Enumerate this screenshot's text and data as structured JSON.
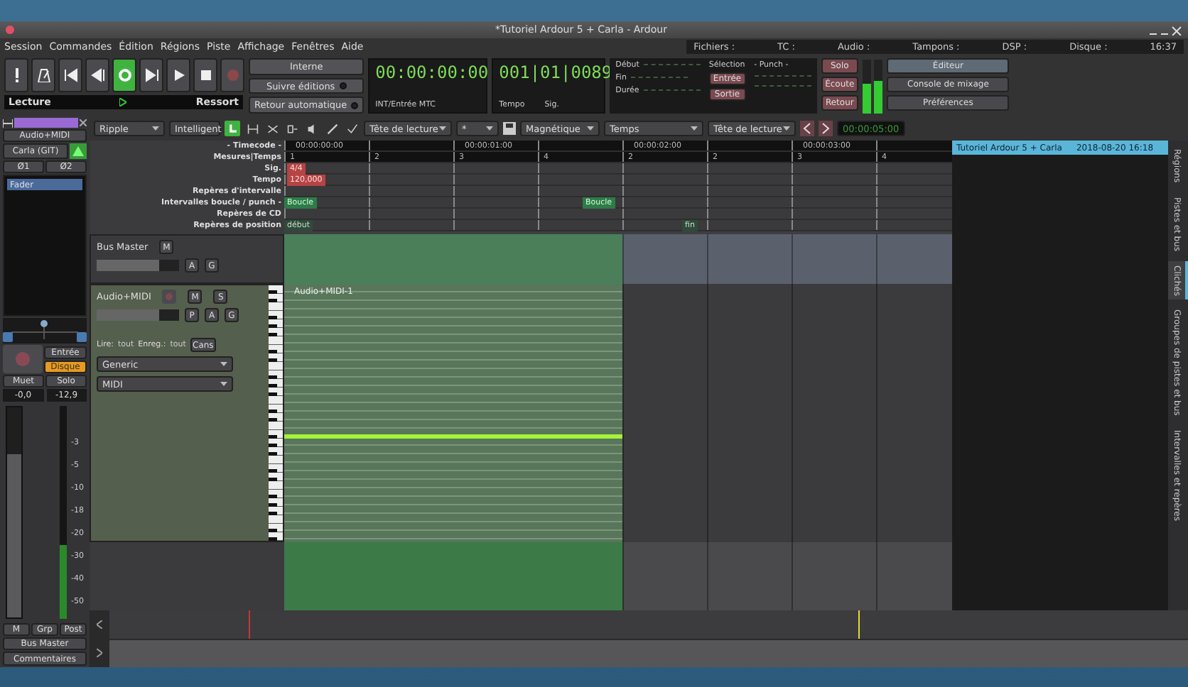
{
  "window": {
    "title": "*Tutoriel Ardour 5 + Carla - Ardour"
  },
  "menu": [
    "Session",
    "Commandes",
    "Édition",
    "Régions",
    "Piste",
    "Affichage",
    "Fenêtres",
    "Aide"
  ],
  "status": [
    "Fichiers :",
    "TC :",
    "Audio :",
    "Tampons :",
    "DSP :",
    "Disque :"
  ],
  "clock_time": "16:37",
  "transport": {
    "buttons": [
      {
        "kind": "alert",
        "on": false
      },
      {
        "kind": "metronome",
        "on": false
      },
      {
        "kind": "to-start",
        "on": false
      },
      {
        "kind": "to-prev",
        "on": false
      },
      {
        "kind": "loop",
        "on": true
      },
      {
        "kind": "to-end",
        "on": false
      },
      {
        "kind": "play",
        "on": false
      },
      {
        "kind": "stop",
        "on": false
      },
      {
        "kind": "record",
        "on": false
      }
    ],
    "sync": "Interne",
    "follow_edits": {
      "label": "Suivre éditions",
      "on": false
    },
    "auto_return": {
      "label": "Retour automatique",
      "on": false
    },
    "mode_left": "Lecture",
    "mode_right": "Ressort"
  },
  "clocks": {
    "primary": "00:00:00:00",
    "primary_info": "INT/Entrée MTC",
    "secondary": "001|01|0089",
    "tempo_label": "Tempo",
    "sig_label": "Sig."
  },
  "selection": {
    "title": "Sélection",
    "punch_title": "- Punch -",
    "rows": [
      "Début",
      "Fin",
      "Durée"
    ],
    "punch_in": "Entrée",
    "punch_out": "Sortie"
  },
  "monitor": [
    "Solo",
    "Écoute",
    "Retour"
  ],
  "windows": [
    {
      "label": "Éditeur",
      "selected": true
    },
    {
      "label": "Console de mixage",
      "selected": false
    },
    {
      "label": "Préférences",
      "selected": false
    }
  ],
  "toolbar": {
    "edit_mode": "Ripple",
    "tool_mode": "Intelligent",
    "edit_point": "Tête de lecture",
    "zoom_focus": "*",
    "snap_mode": "Magnétique",
    "grid": "Temps",
    "nudge_point": "Tête de lecture",
    "nudge_clock": "00:00:05:00",
    "tools": [
      {
        "kind": "grab",
        "selected": true
      },
      {
        "kind": "range",
        "selected": false
      },
      {
        "kind": "cut",
        "selected": false
      },
      {
        "kind": "stretch",
        "selected": false
      },
      {
        "kind": "audition",
        "selected": false
      },
      {
        "kind": "draw",
        "selected": false
      },
      {
        "kind": "internal",
        "selected": false
      }
    ]
  },
  "rulers": [
    {
      "kind": "timecode",
      "label": "- Timecode -",
      "marks": [
        "00:00:00:00",
        "00:00:01:00",
        "00:00:02:00",
        "00:00:03:00"
      ]
    },
    {
      "kind": "bars",
      "label": "Mesures|Temps",
      "marks": [
        "1",
        "2",
        "3",
        "4",
        "2",
        "2",
        "3",
        "4"
      ]
    },
    {
      "kind": "sig",
      "label": "Sig.",
      "marks": [
        "4/4"
      ]
    },
    {
      "kind": "tempo",
      "label": "Tempo",
      "marks": [
        "120,000"
      ]
    },
    {
      "kind": "range",
      "label": "Repères d'intervalle"
    },
    {
      "kind": "loop",
      "label": "Intervalles boucle / punch -",
      "marks": [
        "Boucle",
        "Boucle"
      ]
    },
    {
      "kind": "cd",
      "label": "Repères de CD"
    },
    {
      "kind": "location",
      "label": "Repères de position",
      "marks": [
        "début",
        "fin"
      ]
    }
  ],
  "tracks": [
    {
      "kind": "bus",
      "name": "Bus Master",
      "level": 0.75,
      "buttons": [
        "M",
        "A",
        "G"
      ]
    },
    {
      "kind": "midi",
      "name": "Audio+MIDI",
      "level": 0.75,
      "buttons": [
        "M",
        "S",
        "P",
        "A",
        "G"
      ],
      "playback_label": "Lire:",
      "playback": "tout",
      "record_label": "Enreg.:",
      "record": "tout",
      "extra_button": "Cans",
      "selectors": [
        "Generic",
        "MIDI"
      ],
      "region": "Audio+MIDI-1"
    }
  ],
  "strip": {
    "name": "Audio+MIDI",
    "input": "Carla (GIT)",
    "phase": [
      "Ø1",
      "Ø2"
    ],
    "plugins": [
      {
        "label": "Fader",
        "selected": true
      }
    ],
    "monitoring": [
      {
        "label": "Entrée",
        "selected": false
      },
      {
        "label": "Disque",
        "selected": true
      }
    ],
    "mute": "Muet",
    "solo": "Solo",
    "gain": "-0,0",
    "peak": "-12,9",
    "fader": {
      "level": 0.78
    },
    "meter": {
      "level": 0.35
    },
    "scale": [
      "-3",
      "-5",
      "-10",
      "-18",
      "-20",
      "-30",
      "-40",
      "-50"
    ],
    "bottom": [
      "M",
      "Grp",
      "Post"
    ],
    "output": "Bus Master",
    "comments": "Commentaires"
  },
  "sidebar": {
    "tabs": [
      {
        "label": "Régions",
        "selected": false
      },
      {
        "label": "Pistes et bus",
        "selected": false
      },
      {
        "label": "Clichés",
        "selected": true
      },
      {
        "label": "Groupes de pistes et bus",
        "selected": false
      },
      {
        "label": "Intervalles et repères",
        "selected": false
      }
    ],
    "items": [
      {
        "name": "Tutoriel Ardour 5 + Carla",
        "date": "2018-08-20 16:18",
        "selected": true
      }
    ]
  }
}
